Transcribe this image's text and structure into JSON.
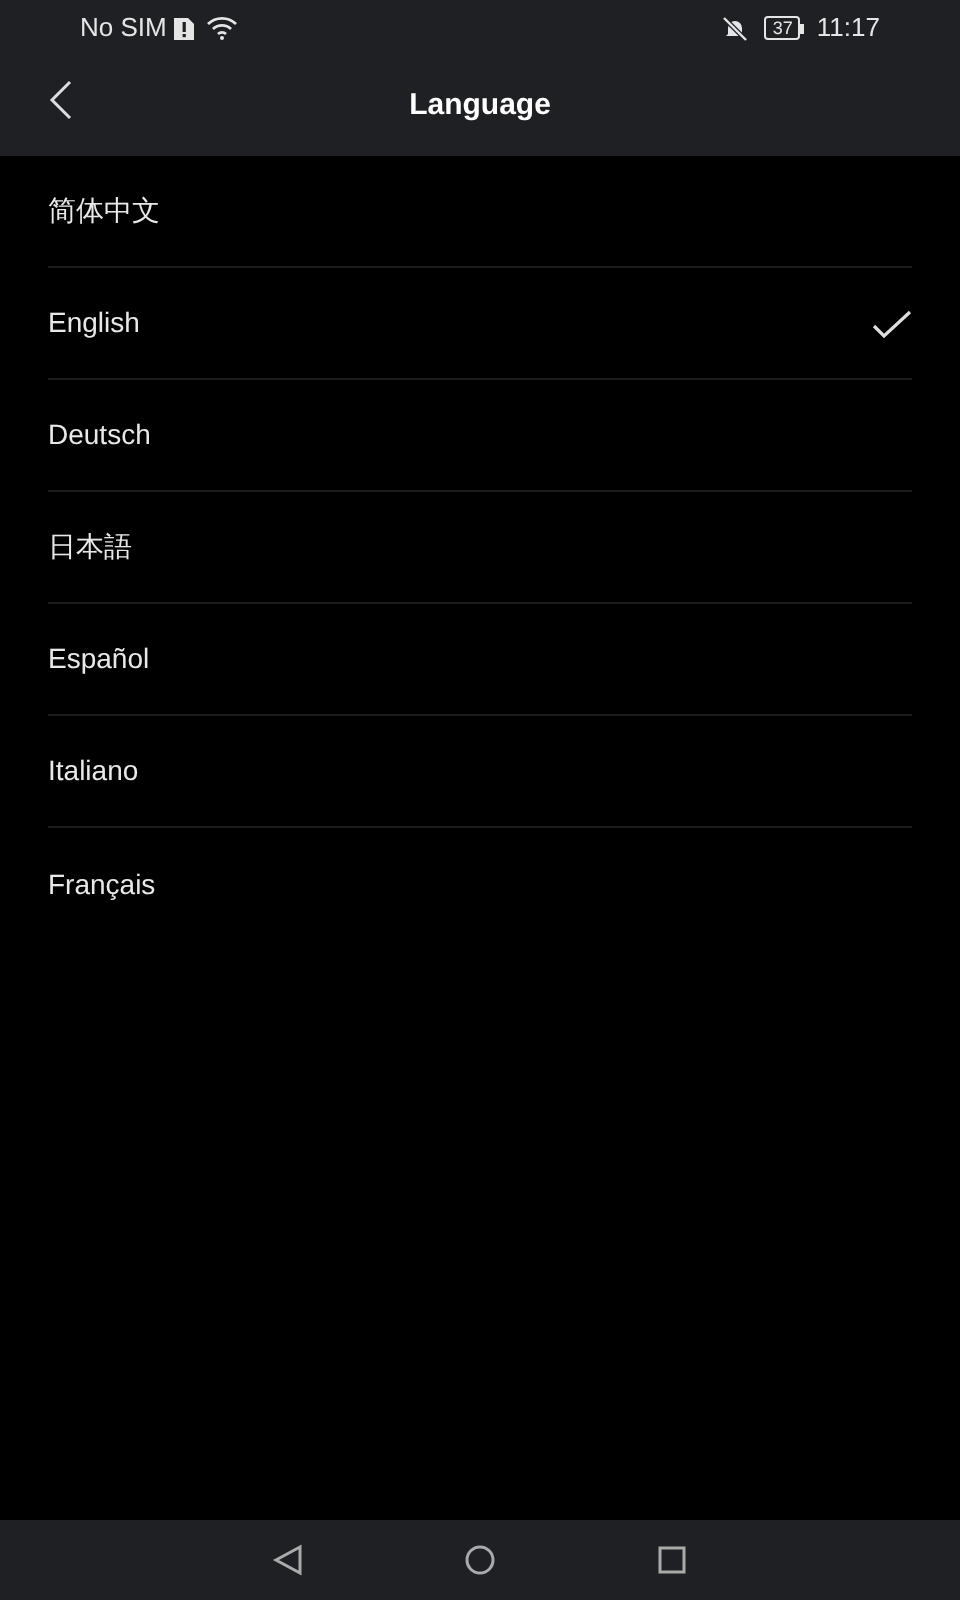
{
  "status_bar": {
    "carrier": "No SIM",
    "battery": "37",
    "time": "11:17"
  },
  "header": {
    "title": "Language"
  },
  "languages": [
    {
      "label": "简体中文",
      "selected": false
    },
    {
      "label": "English",
      "selected": true
    },
    {
      "label": "Deutsch",
      "selected": false
    },
    {
      "label": "日本語",
      "selected": false
    },
    {
      "label": "Español",
      "selected": false
    },
    {
      "label": "Italiano",
      "selected": false
    },
    {
      "label": "Français",
      "selected": false
    }
  ]
}
